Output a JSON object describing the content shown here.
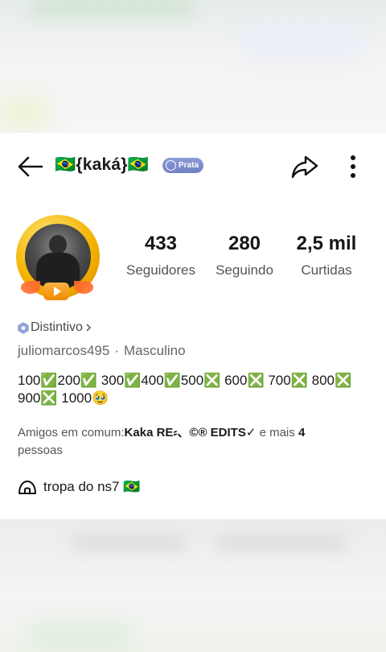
{
  "header": {
    "title": "🇧🇷{kaká}🇧🇷",
    "badge_label": "Prata"
  },
  "stats": [
    {
      "value": "433",
      "label": "Seguidores"
    },
    {
      "value": "280",
      "label": "Seguindo"
    },
    {
      "value": "2,5 mil",
      "label": "Curtidas"
    }
  ],
  "profile": {
    "distintivo": "Distintivo",
    "username": "juliomarcos495",
    "gender": "Masculino",
    "bio": "100✅200✅ 300✅400✅500❎ 600❎ 700❎ 800❎ 900❎ 1000🥹"
  },
  "friends": {
    "prefix": "Amigos em comum:",
    "names": "Kaka RE⸗、©® EDITS✓",
    "middle": " e mais ",
    "count": "4",
    "suffix": "pessoas"
  },
  "group": {
    "name": "tropa do ns7 🇧🇷"
  },
  "colors": {
    "accent_badge": "#7d8cd0",
    "avatar_ring": "#f4b400",
    "text_primary": "#1a1a1a",
    "text_secondary": "#555555"
  },
  "icons": [
    "back-arrow-icon",
    "silver-badge-icon",
    "share-icon",
    "more-vertical-icon",
    "hexagon-badge-icon",
    "chevron-right-icon",
    "group-dome-icon"
  ]
}
